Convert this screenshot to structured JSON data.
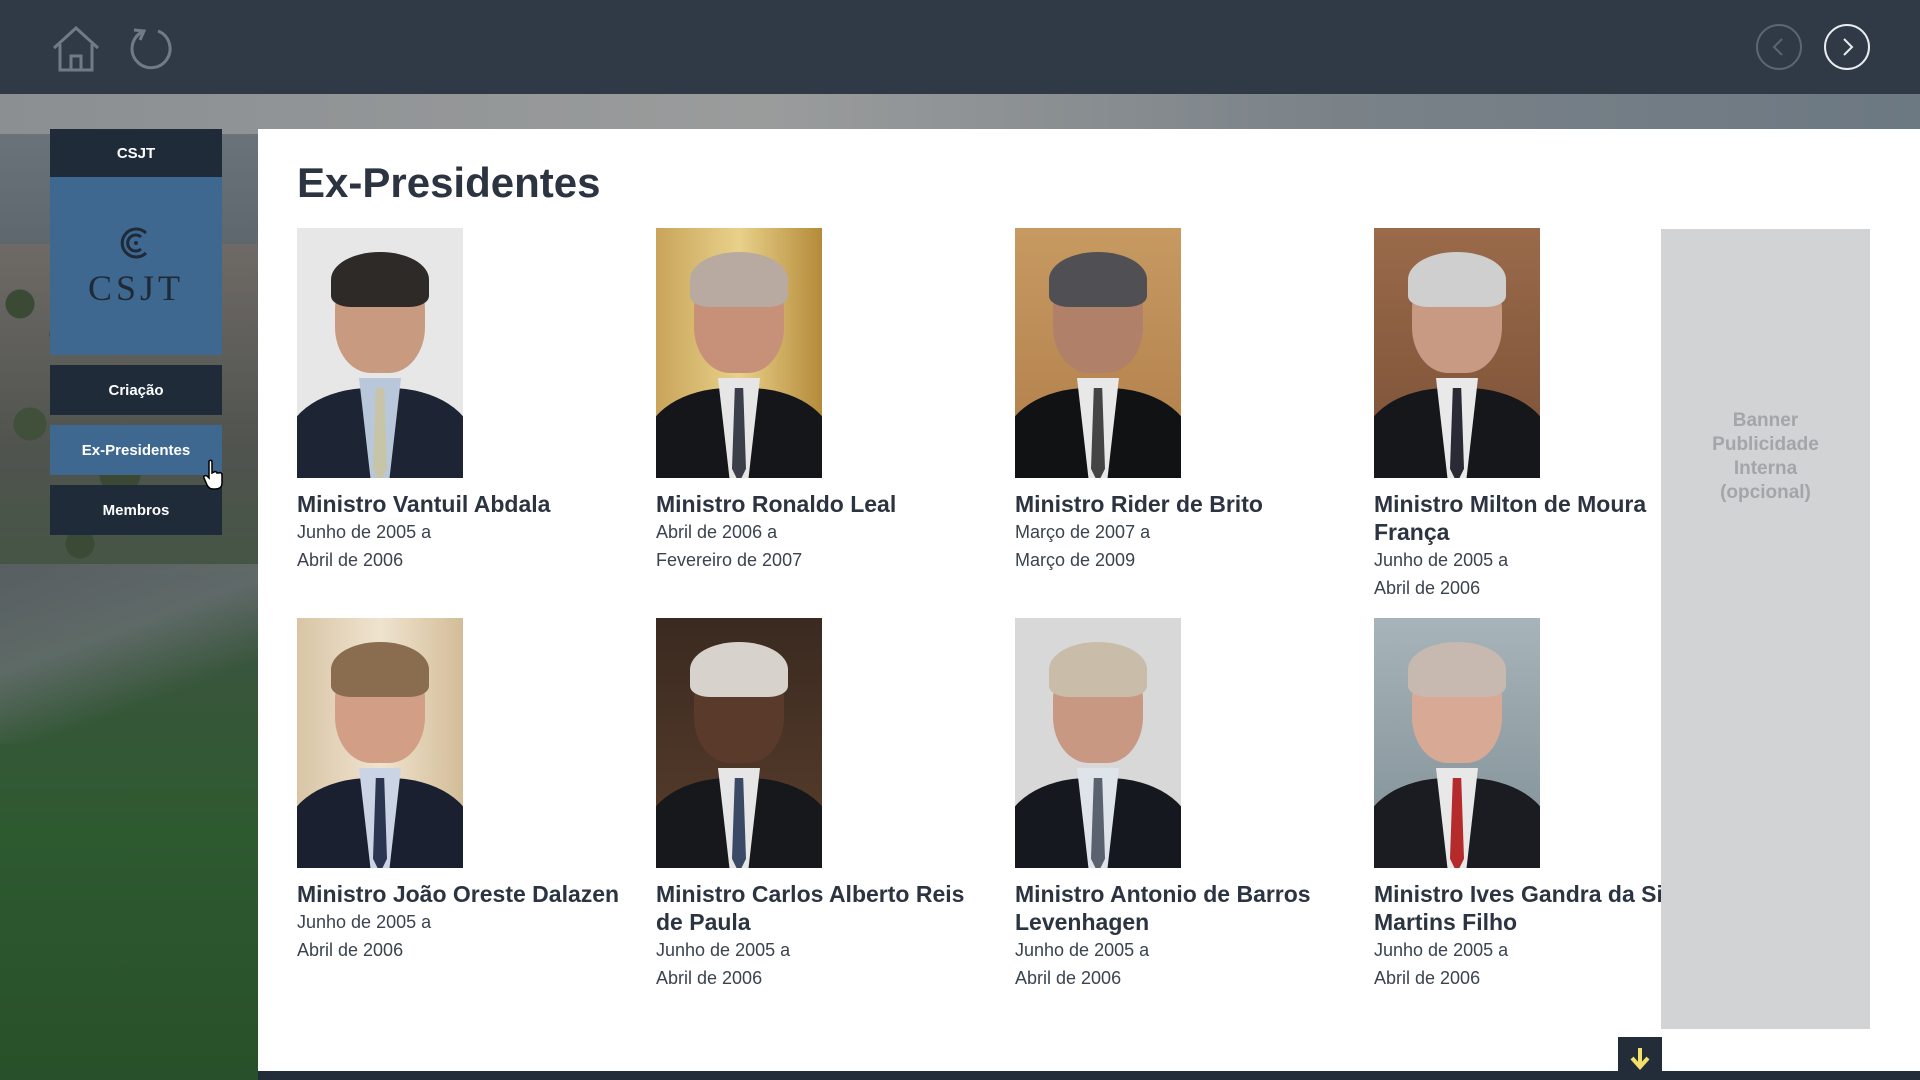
{
  "topbar": {
    "home_icon": "home-icon",
    "refresh_icon": "refresh-icon",
    "prev_icon": "chevron-left-icon",
    "next_icon": "chevron-right-icon"
  },
  "sidebar": {
    "header": "CSJT",
    "logo_text": "CSJT",
    "items": [
      {
        "label": "Criação",
        "active": false
      },
      {
        "label": "Ex-Presidentes",
        "active": true
      },
      {
        "label": "Membros",
        "active": false
      }
    ]
  },
  "main": {
    "title": "Ex-Presidentes",
    "presidents": [
      {
        "name": "Ministro Vantuil Abdala",
        "start": "Junho de 2005 a",
        "end": "Abril de 2006"
      },
      {
        "name": "Ministro Ronaldo Leal",
        "start": "Abril de 2006 a",
        "end": "Fevereiro de 2007"
      },
      {
        "name": "Ministro Rider de Brito",
        "start": "Março de 2007 a",
        "end": "Março de 2009"
      },
      {
        "name": "Ministro Milton de Moura França",
        "start": "Junho de 2005 a",
        "end": "Abril de 2006"
      },
      {
        "name": "Ministro João Oreste Dalazen",
        "start": "Junho de 2005 a",
        "end": "Abril de 2006"
      },
      {
        "name": "Ministro Carlos Alberto Reis de Paula",
        "start": "Junho de 2005 a",
        "end": "Abril de 2006"
      },
      {
        "name": "Ministro Antonio de Barros Levenhagen",
        "start": "Junho de 2005 a",
        "end": "Abril de 2006"
      },
      {
        "name": "Ministro Ives Gandra da Silva Martins Filho",
        "start": "Junho de 2005 a",
        "end": "Abril de 2006"
      }
    ],
    "banner_text": "Banner Publicidade Interna (opcional)",
    "scroll_icon": "arrow-down-icon"
  },
  "colors": {
    "topbar": "#2f3a46",
    "sidebar_dark": "#1f2b38",
    "sidebar_active": "#3f6890",
    "scroll_arrow": "#f2e06a"
  }
}
